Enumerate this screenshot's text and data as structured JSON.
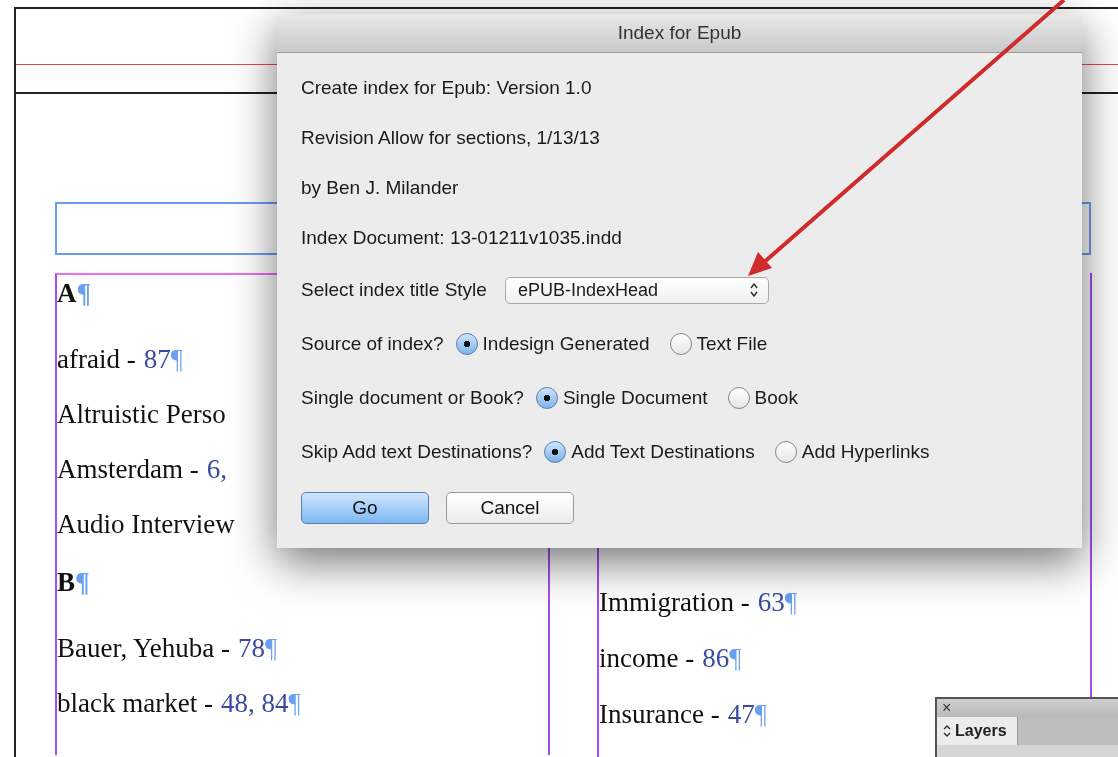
{
  "document": {
    "columns": [
      {
        "entries": [
          {
            "kind": "heading",
            "text": "A",
            "end_mark": "¶"
          },
          {
            "kind": "entry",
            "term": "afraid -",
            "pages": "87",
            "end_mark": "¶"
          },
          {
            "kind": "entry",
            "term": "Altruistic Perso"
          },
          {
            "kind": "entry",
            "term": "Amsterdam -",
            "pages": "6,"
          },
          {
            "kind": "entry",
            "term": "Audio Interview"
          },
          {
            "kind": "heading",
            "text": "B",
            "end_mark": "¶"
          },
          {
            "kind": "entry",
            "term": "Bauer, Yehuba -",
            "pages": "78",
            "end_mark": "¶"
          },
          {
            "kind": "entry",
            "term": "black market -",
            "pages": "48, 84",
            "end_mark": "¶"
          }
        ]
      },
      {
        "entries": [
          {
            "kind": "entry",
            "term": "Immigration -",
            "pages": "63",
            "end_mark": "¶"
          },
          {
            "kind": "entry",
            "term": "income -",
            "pages": "86",
            "end_mark": "¶"
          },
          {
            "kind": "entry",
            "term": "Insurance -",
            "pages": "47",
            "end_mark": "¶"
          }
        ]
      }
    ]
  },
  "dialog": {
    "title": "Index for Epub",
    "rows": [
      {
        "kind": "text",
        "text": "Create index for Epub:  Version 1.0"
      },
      {
        "kind": "text",
        "text": "Revision Allow for sections, 1/13/13"
      },
      {
        "kind": "text",
        "text": "by Ben J. Milander"
      },
      {
        "kind": "text",
        "text": "Index Document: 13-01211v1035.indd"
      },
      {
        "kind": "select",
        "label": "Select index title Style",
        "value": "ePUB-IndexHead"
      },
      {
        "kind": "radio",
        "label": "Source of index?",
        "options": [
          {
            "label": "Indesign Generated",
            "selected": true
          },
          {
            "label": "Text File",
            "selected": false
          }
        ]
      },
      {
        "kind": "radio",
        "label": "Single document or Book?",
        "options": [
          {
            "label": "Single Document",
            "selected": true
          },
          {
            "label": "Book",
            "selected": false
          }
        ]
      },
      {
        "kind": "radio",
        "label": "Skip Add text Destinations?",
        "options": [
          {
            "label": "Add Text Destinations",
            "selected": true
          },
          {
            "label": "Add Hyperlinks",
            "selected": false
          }
        ]
      }
    ],
    "buttons": [
      {
        "label": "Go",
        "default": true
      },
      {
        "label": "Cancel",
        "default": false
      }
    ]
  },
  "layers_panel": {
    "close": "×",
    "tab": "Layers"
  }
}
